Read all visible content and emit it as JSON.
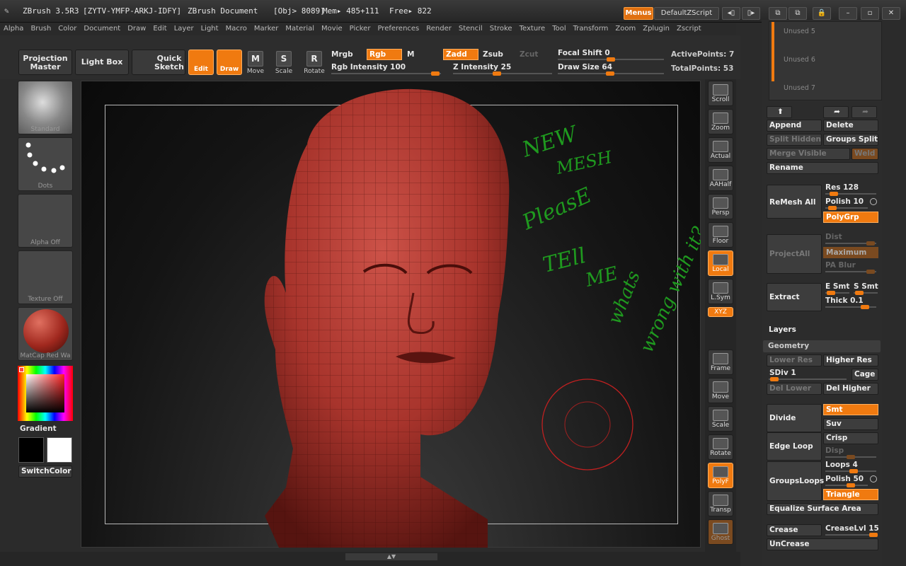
{
  "titlebar": {
    "app": "ZBrush 3.5R3",
    "serial": "[ZYTV-YMFP-ARKJ-IDFY]",
    "document": "ZBrush Document",
    "obj": "[Obj> 8089]",
    "mem": "Mem▸ 485+111",
    "free": "Free▸ 822",
    "menus": "Menus",
    "script": "DefaultZScript"
  },
  "menu": [
    "Alpha",
    "Brush",
    "Color",
    "Document",
    "Draw",
    "Edit",
    "Layer",
    "Light",
    "Macro",
    "Marker",
    "Material",
    "Movie",
    "Picker",
    "Preferences",
    "Render",
    "Stencil",
    "Stroke",
    "Texture",
    "Tool",
    "Transform",
    "Zoom",
    "Zplugin",
    "Zscript"
  ],
  "toolbar": {
    "projection": "Projection Master",
    "lightbox": "Light Box",
    "quicksketch": "Quick Sketch",
    "edit": "Edit",
    "draw": "Draw",
    "move": "Move",
    "scale": "Scale",
    "rotate": "Rotate",
    "mrgb": "Mrgb",
    "rgb": "Rgb",
    "m": "M",
    "zadd": "Zadd",
    "zsub": "Zsub",
    "zcut": "Zcut",
    "rgb_intensity": "Rgb Intensity 100",
    "z_intensity": "Z Intensity 25",
    "focal_shift": "Focal Shift 0",
    "draw_size": "Draw Size 64",
    "active_points": "ActivePoints: 7",
    "total_points": "TotalPoints: 53"
  },
  "left": {
    "brush": "Standard",
    "stroke": "Dots",
    "alpha": "Alpha Off",
    "texture": "Texture Off",
    "material": "MatCap Red Wa",
    "gradient": "Gradient",
    "switchcolor": "SwitchColor"
  },
  "righttools": [
    "Scroll",
    "Zoom",
    "Actual",
    "AAHalf",
    "Persp",
    "Floor",
    "Local",
    "L.Sym",
    "XYZ",
    "Frame",
    "Move",
    "Scale",
    "Rotate",
    "PolyF",
    "Transp",
    "Ghost"
  ],
  "subtool": {
    "unused": [
      "Unused 5",
      "Unused 6",
      "Unused 7"
    ],
    "append": "Append",
    "delete": "Delete",
    "split_hidden": "Split Hidden",
    "groups_split": "Groups Split",
    "merge_visible": "Merge Visible",
    "weld": "Weld",
    "rename": "Rename",
    "remesh_all": "ReMesh All",
    "res": "Res 128",
    "polish": "Polish 10",
    "polygrp": "PolyGrp",
    "projectall": "ProjectAll",
    "dist": "Dist",
    "maximum": "Maximum",
    "pa_blur": "PA Blur",
    "extract": "Extract",
    "e_smt": "E Smt",
    "s_smt": "S Smt",
    "thick": "Thick 0.1"
  },
  "layers": {
    "title": "Layers"
  },
  "geometry": {
    "title": "Geometry",
    "lower_res": "Lower Res",
    "higher_res": "Higher Res",
    "sdiv": "SDiv 1",
    "cage": "Cage",
    "del_lower": "Del Lower",
    "del_higher": "Del Higher",
    "divide": "Divide",
    "smt": "Smt",
    "suv": "Suv",
    "edge_loop": "Edge Loop",
    "crisp": "Crisp",
    "disp": "Disp",
    "groupsloops": "GroupsLoops",
    "loops": "Loops 4",
    "polish50": "Polish 50",
    "triangle": "Triangle",
    "equalize": "Equalize Surface Area",
    "crease": "Crease",
    "creaselvl": "CreaseLvl 15",
    "uncrease": "UnCrease"
  },
  "annotation": [
    "NEW",
    "MESH",
    "PleasE",
    "TEll",
    "ME",
    "whats",
    "wrong with it?"
  ],
  "colors": {
    "accent": "#f07a10",
    "mesh": "#b13a32",
    "ink": "#1f9a1f"
  }
}
